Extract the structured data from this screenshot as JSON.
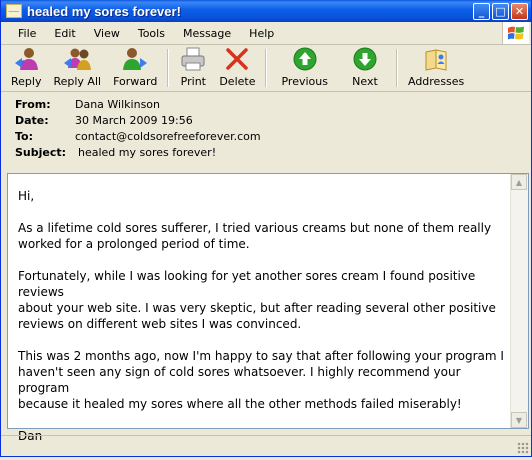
{
  "window": {
    "title": "healed my sores forever!"
  },
  "title_buttons": {
    "minimize": "_",
    "maximize": "□",
    "close": "✕"
  },
  "menu": [
    "File",
    "Edit",
    "View",
    "Tools",
    "Message",
    "Help"
  ],
  "toolbar": {
    "reply": "Reply",
    "reply_all": "Reply All",
    "forward": "Forward",
    "print": "Print",
    "delete": "Delete",
    "previous": "Previous",
    "next": "Next",
    "addresses": "Addresses"
  },
  "header": {
    "from_label": "From:",
    "from": "Dana Wilkinson",
    "date_label": "Date:",
    "date": "30 March 2009 19:56",
    "to_label": "To:",
    "to": "contact@coldsorefreeforever.com",
    "subject_label": "Subject:",
    "subject": "healed my sores forever!"
  },
  "message": {
    "greeting": "Hi,",
    "p1": "As a lifetime cold sores sufferer, I tried various creams but none of them really\nworked for a prolonged period of time.",
    "p2": "Fortunately, while I was looking for yet another sores cream I found positive reviews\nabout your web site. I was very skeptic, but after reading several other positive\nreviews on different web sites I was convinced.",
    "p3": "This was 2 months ago, now I'm happy to say that after following your program I\nhaven't seen any sign of cold sores whatsoever. I highly recommend your program\nbecause it healed my sores where all the other methods failed miserably!",
    "signature": "Dan"
  },
  "colors": {
    "titlebar": "#0a5ee8",
    "window_bg": "#ece9d8",
    "green_nav": "#2ea52e",
    "delete_red": "#d8331c"
  }
}
